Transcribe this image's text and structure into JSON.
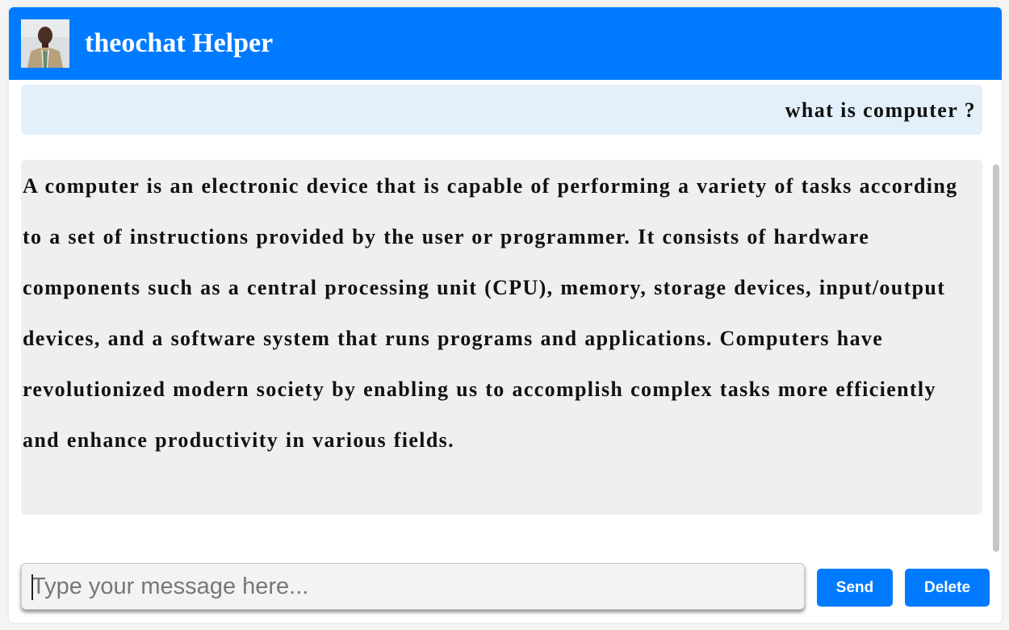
{
  "header": {
    "title": "theochat Helper",
    "avatar_icon": "user-avatar-photo"
  },
  "conversation": {
    "messages": [
      {
        "role": "user",
        "text": "what is computer ?"
      },
      {
        "role": "assistant",
        "text": "A computer is an electronic device that is capable of performing a variety of tasks according to a set of instructions provided by the user or programmer. It consists of hardware components such as a central processing unit (CPU), memory, storage devices, input/output devices, and a software system that runs programs and applications. Computers have revolutionized modern society by enabling us to accomplish complex tasks more efficiently and enhance productivity in various fields."
      }
    ]
  },
  "composer": {
    "placeholder": "Type your message here...",
    "value": "",
    "send_label": "Send",
    "delete_label": "Delete"
  },
  "colors": {
    "accent": "#007bff",
    "user_bubble": "#e3f0fc",
    "assistant_bubble": "#efefef"
  }
}
